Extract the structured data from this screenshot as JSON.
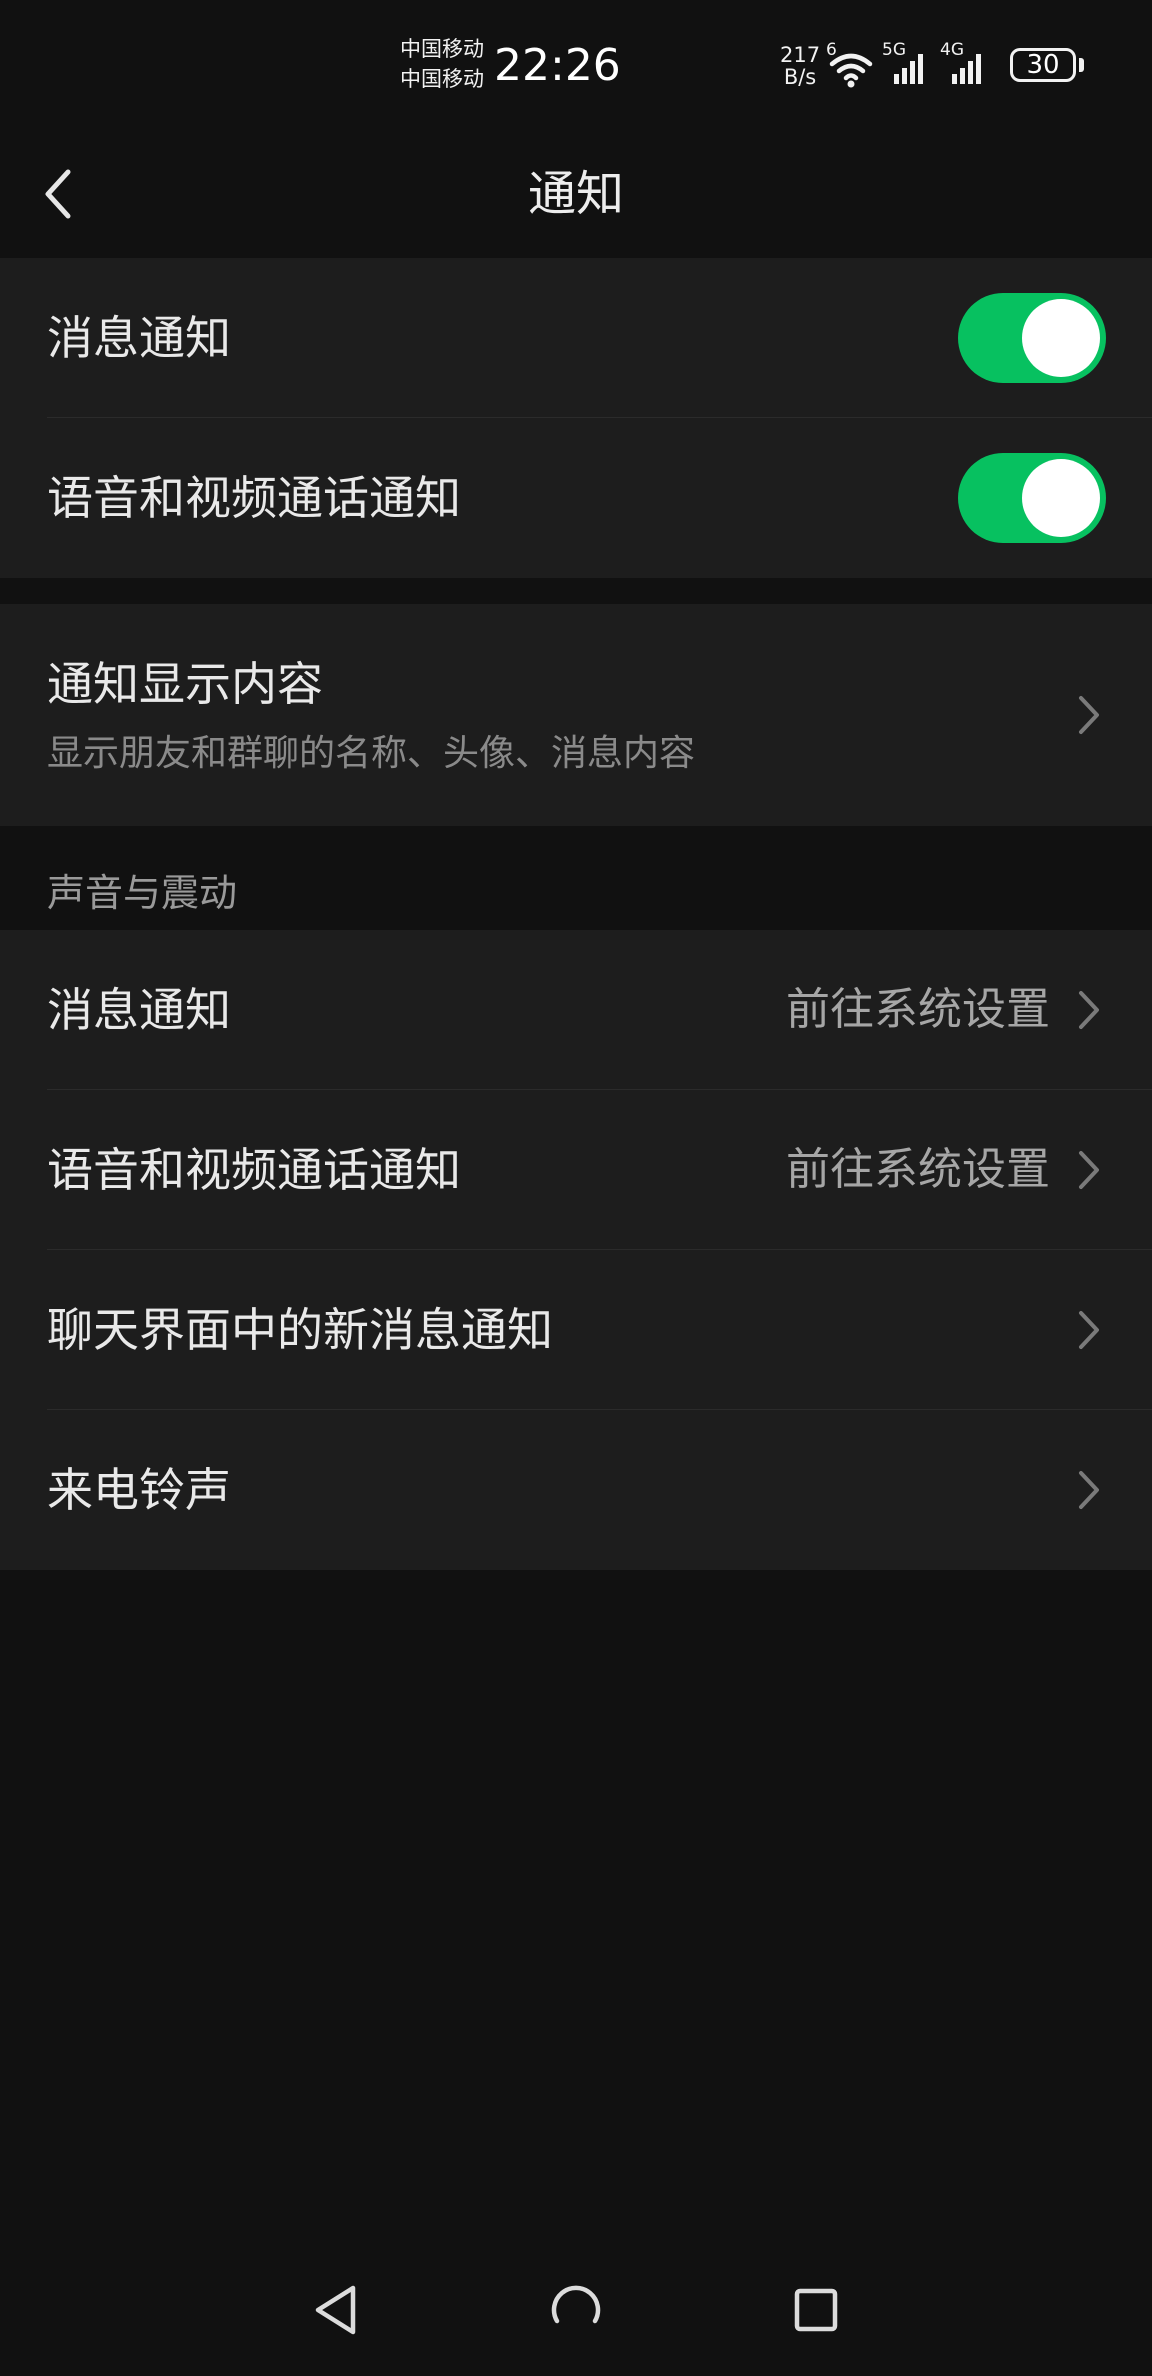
{
  "status_bar": {
    "carrier_1": "中国移动",
    "carrier_2": "中国移动",
    "time": "22:26",
    "net_speed_value": "217",
    "net_speed_unit": "B/s",
    "wifi_badge": "6",
    "signal_1_label": "5G",
    "signal_2_label": "4G",
    "battery_level": "30",
    "icons": [
      "wifi-icon",
      "signal-icon",
      "battery-icon"
    ]
  },
  "header": {
    "title": "通知",
    "back_icon": "chevron-left-icon"
  },
  "group_toggles": {
    "items": [
      {
        "label": "消息通知",
        "enabled": true
      },
      {
        "label": "语音和视频通话通知",
        "enabled": true
      }
    ]
  },
  "group_display": {
    "label": "通知显示内容",
    "subtitle": "显示朋友和群聊的名称、头像、消息内容"
  },
  "sound_section": {
    "header": "声音与震动",
    "items": [
      {
        "label": "消息通知",
        "value": "前往系统设置"
      },
      {
        "label": "语音和视频通话通知",
        "value": "前往系统设置"
      },
      {
        "label": "聊天界面中的新消息通知",
        "value": ""
      },
      {
        "label": "来电铃声",
        "value": ""
      }
    ]
  },
  "nav_bar": {
    "icons": [
      "back-triangle-icon",
      "home-circle-icon",
      "recents-square-icon"
    ]
  },
  "colors": {
    "background": "#111111",
    "card": "#1d1d1d",
    "accent_green": "#07c160",
    "secondary_text": "#a6a6a6"
  }
}
